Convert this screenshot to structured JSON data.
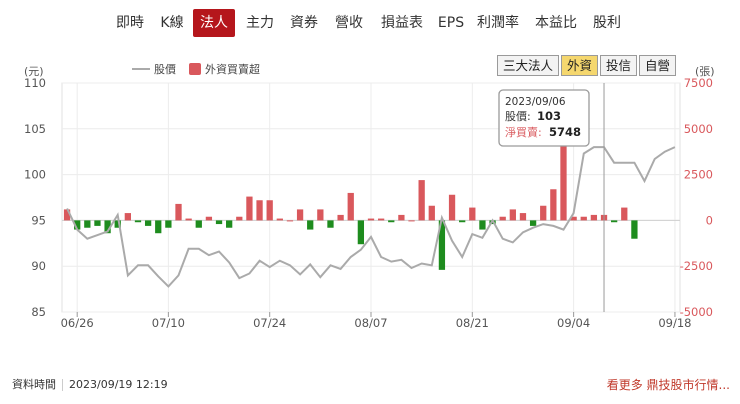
{
  "tabs": [
    {
      "label": "即時",
      "active": false
    },
    {
      "label": "K線",
      "active": false
    },
    {
      "label": "法人",
      "active": true
    },
    {
      "label": "主力",
      "active": false
    },
    {
      "label": "資券",
      "active": false
    },
    {
      "label": "營收",
      "active": false
    },
    {
      "label": "損益表",
      "active": false
    },
    {
      "label": "EPS",
      "active": false
    },
    {
      "label": "利潤率",
      "active": false
    },
    {
      "label": "本益比",
      "active": false
    },
    {
      "label": "股利",
      "active": false
    }
  ],
  "buttons": [
    {
      "label": "三大法人",
      "active": false
    },
    {
      "label": "外資",
      "active": true
    },
    {
      "label": "投信",
      "active": false
    },
    {
      "label": "自營",
      "active": false
    }
  ],
  "colors": {
    "price_line": "#aaaaaa",
    "buy": "#d9585c",
    "sell": "#1e8c1e",
    "accent": "#b5161c"
  },
  "tooltip": {
    "date": "2023/09/06",
    "price_label": "股價:",
    "price_value": "103",
    "net_label": "淨買賣:",
    "net_value": "5748"
  },
  "footer": {
    "time_label": "資料時間",
    "time_value": "2023/09/19 12:19",
    "more_link": "看更多 鼎技股市行情..."
  },
  "chart_data": {
    "type": "bar+line",
    "left_unit": "(元)",
    "right_unit": "(張)",
    "legend": [
      {
        "name": "股價",
        "kind": "line"
      },
      {
        "name": "外資買賣超",
        "kind": "bar"
      }
    ],
    "legend_placement": "top-left",
    "y_left": {
      "range": [
        85,
        110
      ],
      "ticks": [
        85,
        90,
        95,
        100,
        105,
        110
      ]
    },
    "y_right": {
      "range": [
        -5000,
        7500
      ],
      "ticks": [
        -5000,
        -2500,
        0,
        2500,
        5000,
        7500
      ]
    },
    "x_tick_labels": [
      "06/26",
      "07/10",
      "07/24",
      "08/07",
      "08/21",
      "09/04",
      "09/18"
    ],
    "x_tick_index": [
      1,
      10,
      20,
      30,
      40,
      50,
      60
    ],
    "highlight_index": 53,
    "dates": [
      "06/23",
      "06/26",
      "06/27",
      "06/28",
      "06/29",
      "06/30",
      "07/03",
      "07/04",
      "07/05",
      "07/06",
      "07/07",
      "07/10",
      "07/11",
      "07/12",
      "07/13",
      "07/14",
      "07/17",
      "07/18",
      "07/19",
      "07/20",
      "07/21",
      "07/24",
      "07/25",
      "07/26",
      "07/27",
      "07/28",
      "07/31",
      "08/01",
      "08/02",
      "08/03",
      "08/04",
      "08/07",
      "08/08",
      "08/09",
      "08/10",
      "08/11",
      "08/14",
      "08/15",
      "08/16",
      "08/17",
      "08/18",
      "08/21",
      "08/22",
      "08/23",
      "08/24",
      "08/25",
      "08/28",
      "08/29",
      "08/30",
      "08/31",
      "09/01",
      "09/04",
      "09/05",
      "09/06",
      "09/07",
      "09/08",
      "09/11",
      "09/12",
      "09/13",
      "09/14",
      "09/15",
      "09/18"
    ],
    "price": [
      96.3,
      94,
      93,
      93.4,
      93.8,
      95.6,
      89,
      90.1,
      90.1,
      88.9,
      87.8,
      89,
      91.9,
      91.9,
      91.2,
      91.6,
      90.4,
      88.7,
      89.2,
      90.6,
      89.9,
      90.6,
      90.1,
      89.1,
      90.2,
      88.8,
      90.1,
      89.7,
      91,
      91.8,
      93.2,
      91,
      90.5,
      90.7,
      89.8,
      90.3,
      90.1,
      95.3,
      92.8,
      91,
      93.5,
      93.1,
      95,
      93,
      92.6,
      93.7,
      94.2,
      94.6,
      94.4,
      94,
      95.8,
      102.3,
      103,
      103,
      101.3,
      101.3,
      101.3,
      99.3,
      101.7,
      102.5,
      103
    ],
    "net": [
      600,
      -500,
      -400,
      -300,
      -700,
      -400,
      400,
      -100,
      -300,
      -700,
      -400,
      900,
      100,
      -400,
      200,
      -200,
      -400,
      200,
      1300,
      1100,
      1100,
      100,
      0,
      600,
      -500,
      600,
      -400,
      300,
      1500,
      -1300,
      100,
      100,
      -100,
      300,
      0,
      2200,
      800,
      -2700,
      1400,
      -100,
      700,
      -500,
      -200,
      200,
      600,
      400,
      -300,
      800,
      1700,
      5748,
      200,
      200,
      300,
      300,
      -100,
      700,
      -1000
    ]
  }
}
